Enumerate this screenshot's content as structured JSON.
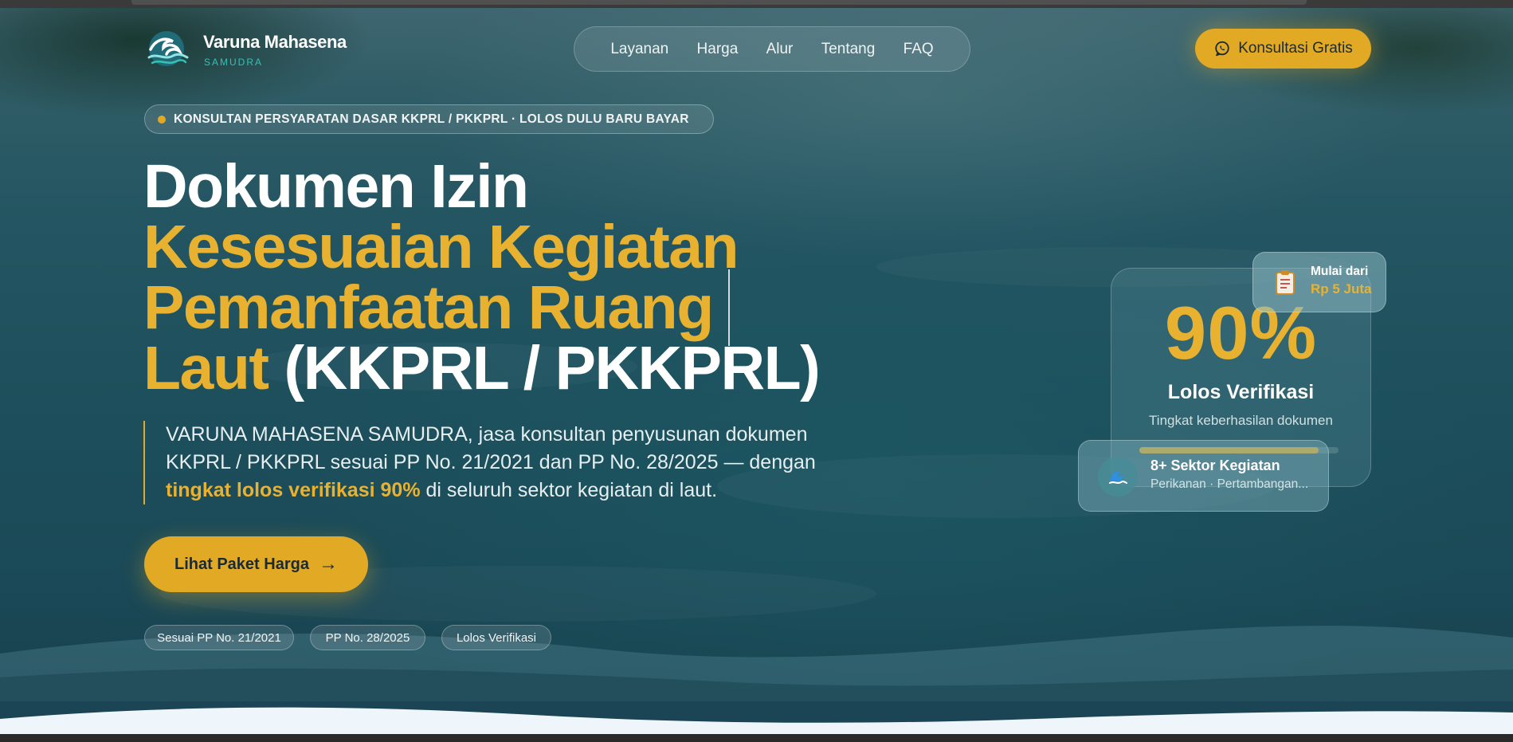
{
  "brand": {
    "name": "Varuna Mahasena",
    "subtitle": "SAMUDRA"
  },
  "nav": {
    "items": [
      {
        "label": "Layanan"
      },
      {
        "label": "Harga"
      },
      {
        "label": "Alur"
      },
      {
        "label": "Tentang"
      },
      {
        "label": "FAQ"
      }
    ],
    "cta_label": "Konsultasi Gratis",
    "cta_icon": "whatsapp-icon"
  },
  "hero": {
    "badge": "KONSULTAN PERSYARATAN DASAR KKPRL / PKKPRL · LOLOS DULU BARU BAYAR",
    "headline": {
      "line1": "Dokumen Izin",
      "line2": "Kesesuaian Kegiatan",
      "line3": "Pemanfaatan Ruang",
      "line4_accent": "Laut",
      "line4_rest": " (KKPRL / PKKPRL)"
    },
    "description": {
      "line1": "VARUNA MAHASENA SAMUDRA, jasa konsultan penyusunan dokumen",
      "line2": "KKPRL / PKKPRL sesuai PP No. 21/2021 dan PP No. 28/2025 — dengan",
      "highlight": "tingkat lolos verifikasi 90%",
      "tail": " di seluruh sektor kegiatan di laut."
    },
    "cta_label": "Lihat Paket Harga",
    "tags": [
      "Sesuai PP No. 21/2021",
      "PP No. 28/2025",
      "Lolos Verifikasi"
    ]
  },
  "stats": {
    "percent": "90%",
    "percent_label": "Lolos Verifikasi",
    "caption": "Tingkat keberhasilan dokumen",
    "progress_fraction": 0.9,
    "price_label": "Mulai dari",
    "price_value": "Rp 5 Juta",
    "sector_title": "8+ Sektor Kegiatan",
    "sector_subtitle": "Perikanan · Pertambangan..."
  },
  "colors": {
    "accent": "#e2aa24",
    "headline_accent": "#e8b230",
    "brand_sub": "#35c1b4",
    "ocean": "#1d4f5c"
  }
}
